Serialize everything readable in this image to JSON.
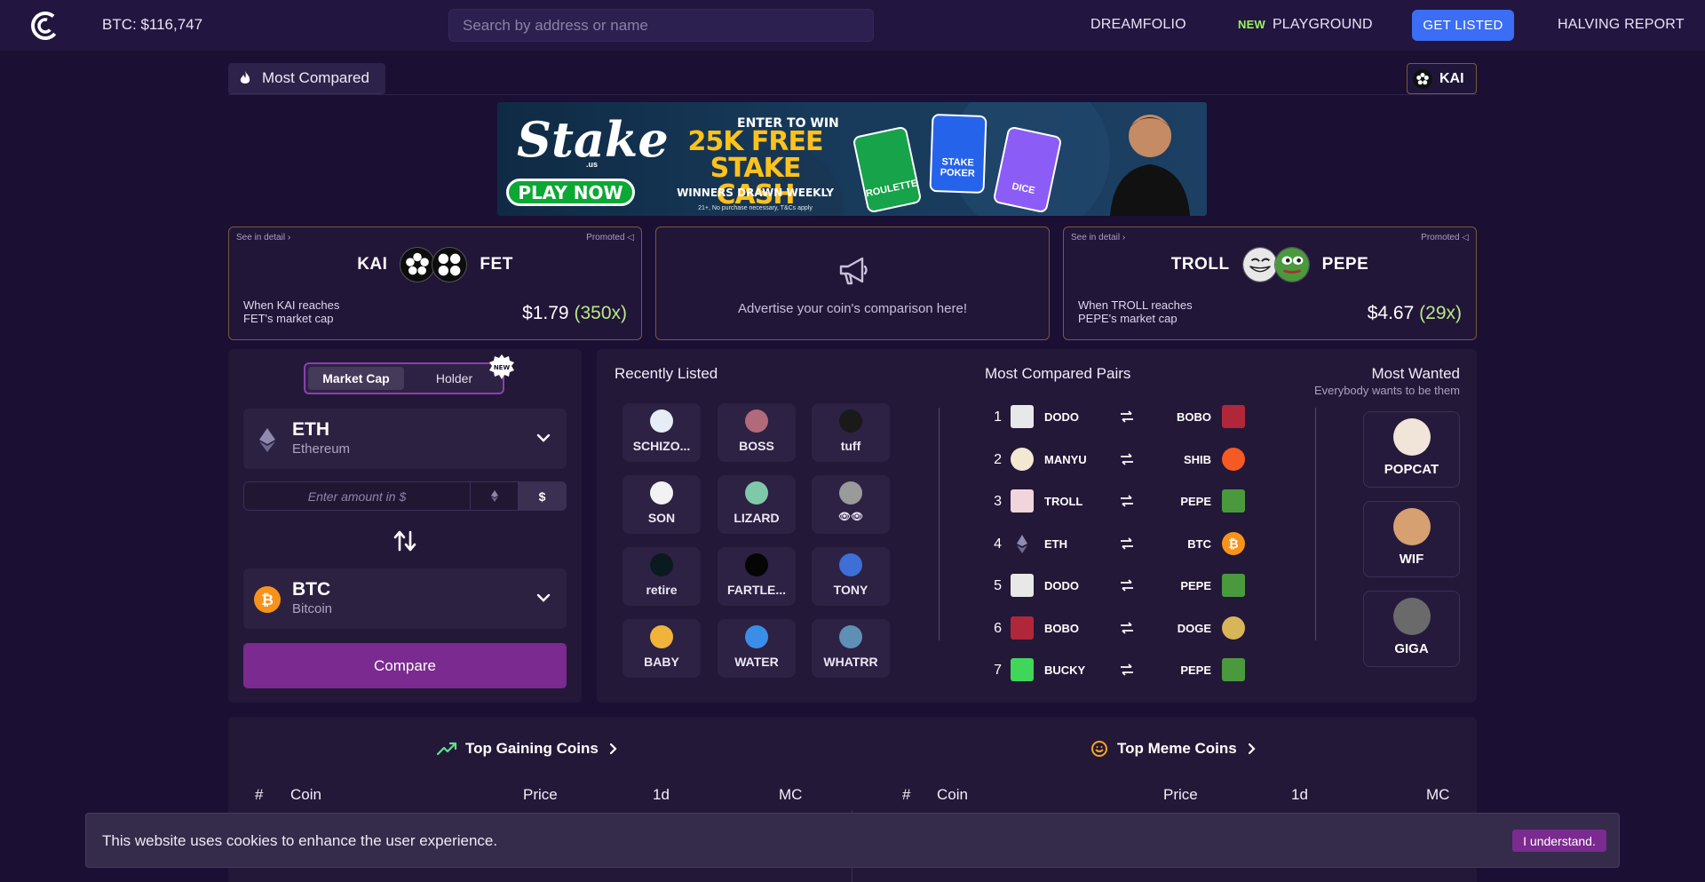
{
  "nav": {
    "btc_price": "BTC: $116,747",
    "search_placeholder": "Search by address or name",
    "dreamfolio": "DREAMFOLIO",
    "new_badge": "NEW",
    "playground": "PLAYGROUND",
    "get_listed": "GET LISTED",
    "halving_report": "HALVING REPORT"
  },
  "subbar": {
    "most_compared": "Most Compared",
    "kai_chip": "KAI"
  },
  "banner": {
    "brand": "Stake",
    "brand_sub": ".us",
    "cta": "PLAY NOW",
    "enter": "ENTER TO WIN",
    "headline": "25K FREE STAKE CASH",
    "winners": "WINNERS DRAWN WEEKLY",
    "tnc": "21+, No purchase necessary, T&Cs apply",
    "card1": "ROULETTE",
    "card2": "STAKE POKER",
    "card3": "DICE"
  },
  "promo_cards": [
    {
      "see_detail": "See in detail",
      "promoted": "Promoted",
      "from": "KAI",
      "to": "FET",
      "when_line1": "When KAI reaches",
      "when_line2": "FET's market cap",
      "price": "$1.79",
      "multiple": "(350x)"
    },
    {
      "see_detail": "See in detail",
      "promoted": "Promoted",
      "from": "TROLL",
      "to": "PEPE",
      "when_line1": "When TROLL reaches",
      "when_line2": "PEPE's market cap",
      "price": "$4.67",
      "multiple": "(29x)"
    }
  ],
  "advert": {
    "text": "Advertise your coin's comparison here!"
  },
  "convert": {
    "tab_market_cap": "Market Cap",
    "tab_holder": "Holder",
    "new_label": "NEW",
    "from_symbol": "ETH",
    "from_name": "Ethereum",
    "amount_placeholder": "Enter amount in $",
    "unit_usd": "$",
    "to_symbol": "BTC",
    "to_name": "Bitcoin",
    "compare_label": "Compare"
  },
  "recently_listed": {
    "title": "Recently Listed",
    "items": [
      "SCHIZO...",
      "BOSS",
      "tuff",
      "SON",
      "LIZARD",
      "👁👁",
      "retire",
      "FARTLE...",
      "TONY",
      "BABY",
      "WATER",
      "WHATRR"
    ]
  },
  "most_compared_pairs": {
    "title": "Most Compared Pairs",
    "rows": [
      {
        "n": "1",
        "a": "DODO",
        "b": "BOBO"
      },
      {
        "n": "2",
        "a": "MANYU",
        "b": "SHIB"
      },
      {
        "n": "3",
        "a": "TROLL",
        "b": "PEPE"
      },
      {
        "n": "4",
        "a": "ETH",
        "b": "BTC"
      },
      {
        "n": "5",
        "a": "DODO",
        "b": "PEPE"
      },
      {
        "n": "6",
        "a": "BOBO",
        "b": "DOGE"
      },
      {
        "n": "7",
        "a": "BUCKY",
        "b": "PEPE"
      }
    ]
  },
  "most_wanted": {
    "title": "Most Wanted",
    "subtitle": "Everybody wants to be them",
    "items": [
      "POPCAT",
      "WIF",
      "GIGA"
    ]
  },
  "tables": {
    "gaining_title": "Top Gaining Coins",
    "meme_title": "Top Meme Coins",
    "col_num": "#",
    "col_coin": "Coin",
    "col_price": "Price",
    "col_1d": "1d",
    "col_mc": "MC"
  },
  "cookie": {
    "text": "This website uses cookies to enhance the user experience.",
    "button": "I understand."
  },
  "colors": {
    "background": "#1b0f33",
    "nav": "#221640",
    "accent_purple": "#7b2a8f",
    "get_listed_blue": "#3b6ef5",
    "new_green": "#9cf45b",
    "multiple_green": "#b8e886"
  }
}
